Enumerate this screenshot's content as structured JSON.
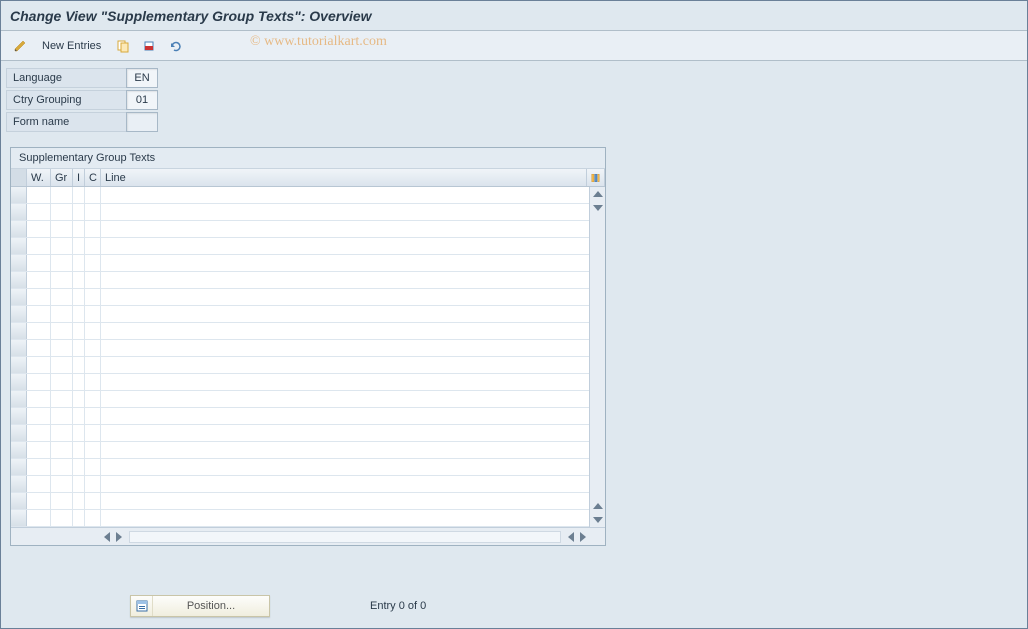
{
  "title": "Change View \"Supplementary Group Texts\": Overview",
  "toolbar": {
    "new_entries_label": "New Entries"
  },
  "watermark": "© www.tutorialkart.com",
  "form": {
    "language_label": "Language",
    "language_value": "EN",
    "ctry_label": "Ctry Grouping",
    "ctry_value": "01",
    "formname_label": "Form name",
    "formname_value": ""
  },
  "table": {
    "title": "Supplementary Group Texts",
    "columns": {
      "w": "W.",
      "gr": "Gr",
      "i": "I",
      "c": "C",
      "line": "Line"
    },
    "row_count": 20
  },
  "footer": {
    "position_label": "Position...",
    "entry_status": "Entry 0 of 0"
  }
}
